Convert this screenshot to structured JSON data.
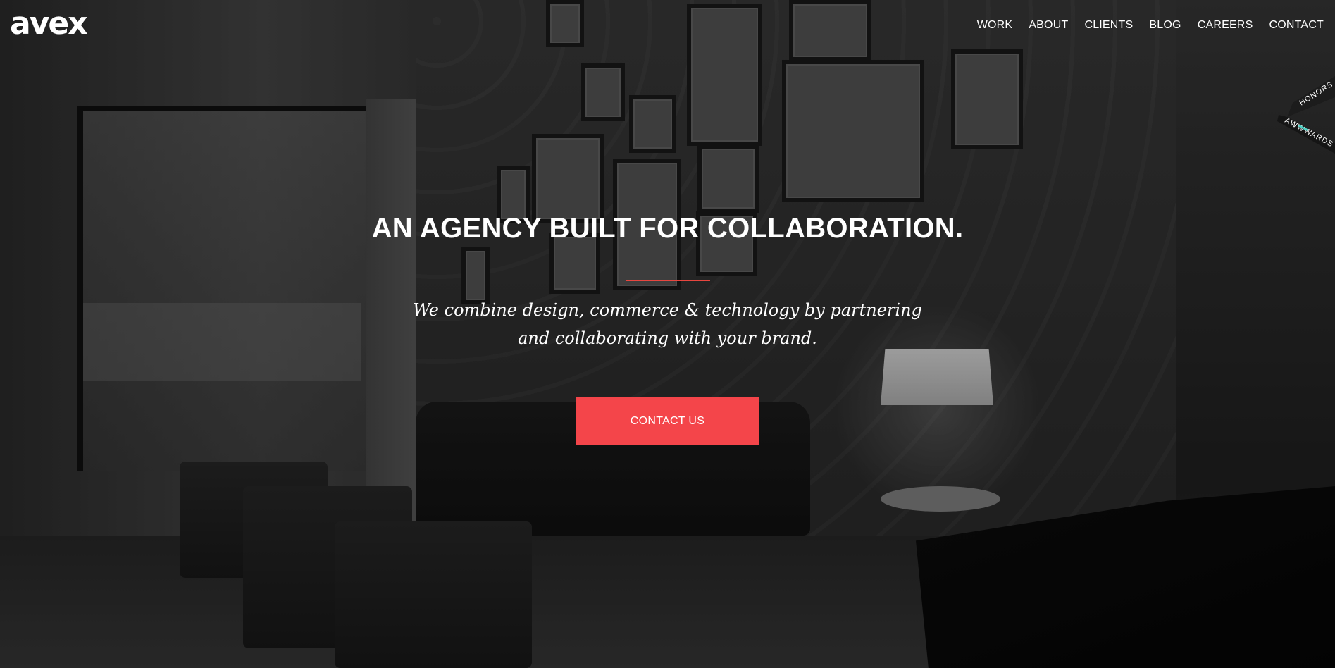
{
  "header": {
    "logo_text": "avex",
    "nav": [
      {
        "label": "WORK"
      },
      {
        "label": "ABOUT"
      },
      {
        "label": "CLIENTS"
      },
      {
        "label": "BLOG"
      },
      {
        "label": "CAREERS"
      },
      {
        "label": "CONTACT"
      }
    ]
  },
  "awards_badge": {
    "top_text": "HONORS",
    "bottom_text": "AWWWARDS"
  },
  "hero": {
    "headline": "AN AGENCY BUILT FOR COLLABORATION.",
    "tagline_line1": "We combine design, commerce & technology by partnering",
    "tagline_line2": "and collaborating with your brand.",
    "cta_label": "CONTACT US"
  },
  "colors": {
    "accent": "#f4454a",
    "divider": "#e8463f",
    "text": "#ffffff",
    "awards_teal": "#4fd1c5"
  }
}
